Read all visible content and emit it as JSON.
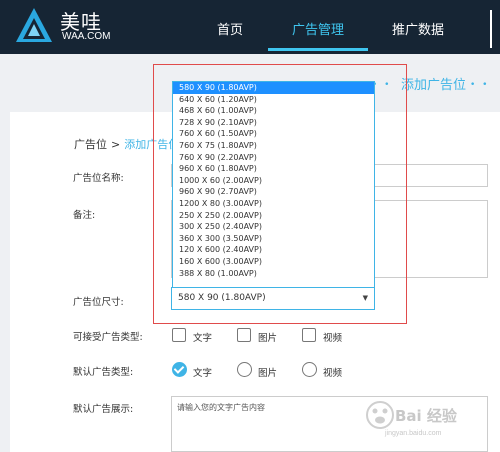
{
  "brand": {
    "name_cn": "美哇",
    "name_en": "WAA.COM"
  },
  "nav": {
    "items": [
      {
        "label": "首页"
      },
      {
        "label": "广告管理",
        "active": true
      },
      {
        "label": "推广数据"
      }
    ]
  },
  "page_title": "添加广告位",
  "breadcrumb": {
    "root": "广告位",
    "separator": ">",
    "current": "添加广告位"
  },
  "form": {
    "name_label": "广告位名称:",
    "note_label": "备注:",
    "size_label": "广告位尺寸:",
    "size_selected": "580 X 90 (1.80AVP)",
    "size_options": [
      "580 X 90 (1.80AVP)",
      "640 X 60 (1.20AVP)",
      "468 X 60 (1.00AVP)",
      "728 X 90 (2.10AVP)",
      "760 X 60 (1.50AVP)",
      "760 X 75 (1.80AVP)",
      "760 X 90 (2.20AVP)",
      "960 X 60 (1.80AVP)",
      "1000 X 60 (2.00AVP)",
      "960 X 90 (2.70AVP)",
      "1200 X 80 (3.00AVP)",
      "250 X 250 (2.00AVP)",
      "300 X 250 (2.40AVP)",
      "360 X 300 (3.50AVP)",
      "120 X 600 (2.40AVP)",
      "160 X 600 (3.00AVP)",
      "388 X 80 (1.00AVP)"
    ],
    "accept_types_label": "可接受广告类型:",
    "accept_types": [
      {
        "label": "文字",
        "checked": false
      },
      {
        "label": "图片",
        "checked": false
      },
      {
        "label": "视频",
        "checked": false
      }
    ],
    "default_type_label": "默认广告类型:",
    "default_types": [
      {
        "label": "文字",
        "selected": true
      },
      {
        "label": "图片",
        "selected": false
      },
      {
        "label": "视频",
        "selected": false
      }
    ],
    "default_display_label": "默认广告展示:",
    "default_display_placeholder": "请输入您的文字广告内容"
  },
  "watermark": {
    "text": "Bai 经验",
    "url": "jingyan.baidu.com"
  },
  "colors": {
    "topbar": "#162534",
    "accent": "#3fb4e6",
    "selected_option": "#1e90ff",
    "highlight_frame": "#e04b4b"
  }
}
